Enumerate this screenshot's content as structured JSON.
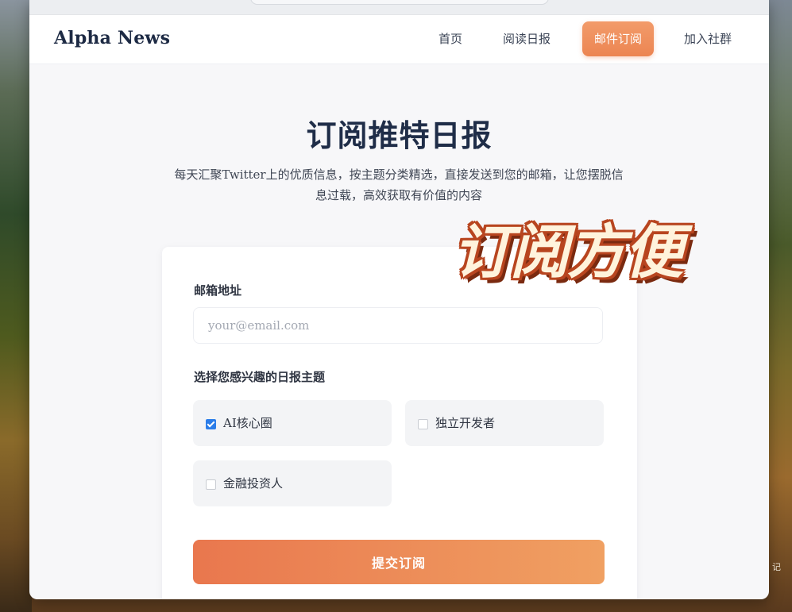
{
  "nav": {
    "logo": "Alpha News",
    "items": [
      {
        "label": "首页",
        "active": false
      },
      {
        "label": "阅读日报",
        "active": false
      },
      {
        "label": "邮件订阅",
        "active": true
      },
      {
        "label": "加入社群",
        "active": false
      }
    ]
  },
  "hero": {
    "title": "订阅推特日报",
    "subtitle_line1": "每天汇聚Twitter上的优质信息，按主题分类精选，直接发送到您的邮箱，让您摆脱信",
    "subtitle_line2": "息过载，高效获取有价值的内容"
  },
  "form": {
    "email_label": "邮箱地址",
    "email_placeholder": "your@email.com",
    "email_value": "",
    "topics_label": "选择您感兴趣的日报主题",
    "topics": [
      {
        "label": "AI核心圈",
        "checked": true
      },
      {
        "label": "独立开发者",
        "checked": false
      },
      {
        "label": "金融投资人",
        "checked": false
      }
    ],
    "submit_label": "提交订阅"
  },
  "sticker": {
    "text": "订阅方便"
  },
  "watermark": {
    "text": "记"
  },
  "colors": {
    "accent": "#ec8552",
    "checkbox": "#2b7de9",
    "title": "#1f2d48"
  }
}
